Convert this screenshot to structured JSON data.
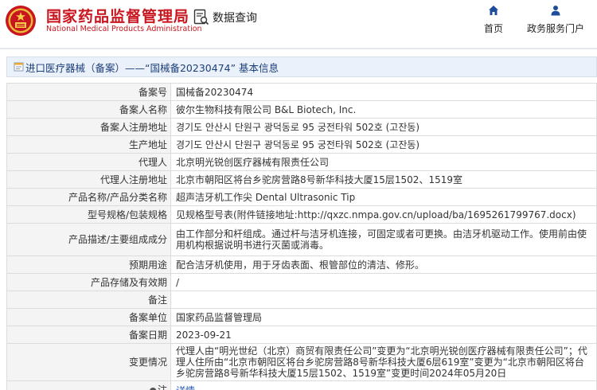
{
  "header": {
    "logo_cn": "国家药品监督管理局",
    "logo_en": "National Medical Products Administration",
    "query_label": "数据查询",
    "nav": [
      {
        "label": "首页",
        "icon": "home-icon"
      },
      {
        "label": "政务服务门户",
        "icon": "person-icon"
      }
    ],
    "brand_color": "#c9151e"
  },
  "title_bar": {
    "text": "进口医疗器械（备案）——“国械备20230474” 基本信息",
    "icon": "document-icon"
  },
  "rows": [
    {
      "label": "备案号",
      "value": "国械备20230474"
    },
    {
      "label": "备案人名称",
      "value": "彼尔生物科技有限公司 B&L Biotech, Inc."
    },
    {
      "label": "备案人注册地址",
      "value": "경기도 안산시 단원구 광덕동로 95 궁전타워 502호 (고잔동)"
    },
    {
      "label": "生产地址",
      "value": "경기도 안산시 단원구 광덕동로 95 궁전타워 502호 (고잔동)"
    },
    {
      "label": "代理人",
      "value": "北京明光锐创医疗器械有限责任公司"
    },
    {
      "label": "代理人注册地址",
      "value": "北京市朝阳区将台乡驼房营路8号新华科技大厦15层1502、1519室"
    },
    {
      "label": "产品名称/产品分类名称",
      "value": "超声洁牙机工作尖 Dental Ultrasonic Tip"
    },
    {
      "label": "型号规格/包装规格",
      "value": "见规格型号表(附件链接地址:http://qxzc.nmpa.gov.cn/upload/ba/1695261799767.docx)"
    },
    {
      "label": "产品描述/主要组成成分",
      "value": "由工作部分和杆组成。通过杆与洁牙机连接，可固定或者可更换。由洁牙机驱动工作。使用前由使用机构根据说明书进行灭菌或消毒。"
    },
    {
      "label": "预期用途",
      "value": "配合洁牙机使用，用于牙齿表面、根管部位的清洁、修形。"
    },
    {
      "label": "产品存储及有效期",
      "value": "/"
    },
    {
      "label": "备注",
      "value": ""
    },
    {
      "label": "备案单位",
      "value": "国家药品监督管理局"
    },
    {
      "label": "备案日期",
      "value": "2023-09-21"
    },
    {
      "label": "变更情况",
      "value": "代理人由“明光世纪（北京）商贸有限责任公司”变更为“北京明光锐创医疗器械有限责任公司”；代理人住所由“北京市朝阳区将台乡驼房营路8号新华科技大厦6层619室”变更为“北京市朝阳区将台乡驼房营路8号新华科技大厦15层1502、1519室”变更时间2024年05月20日"
    }
  ],
  "note_row": {
    "label": "注",
    "icon": "pin-icon",
    "link_text": "详情"
  }
}
